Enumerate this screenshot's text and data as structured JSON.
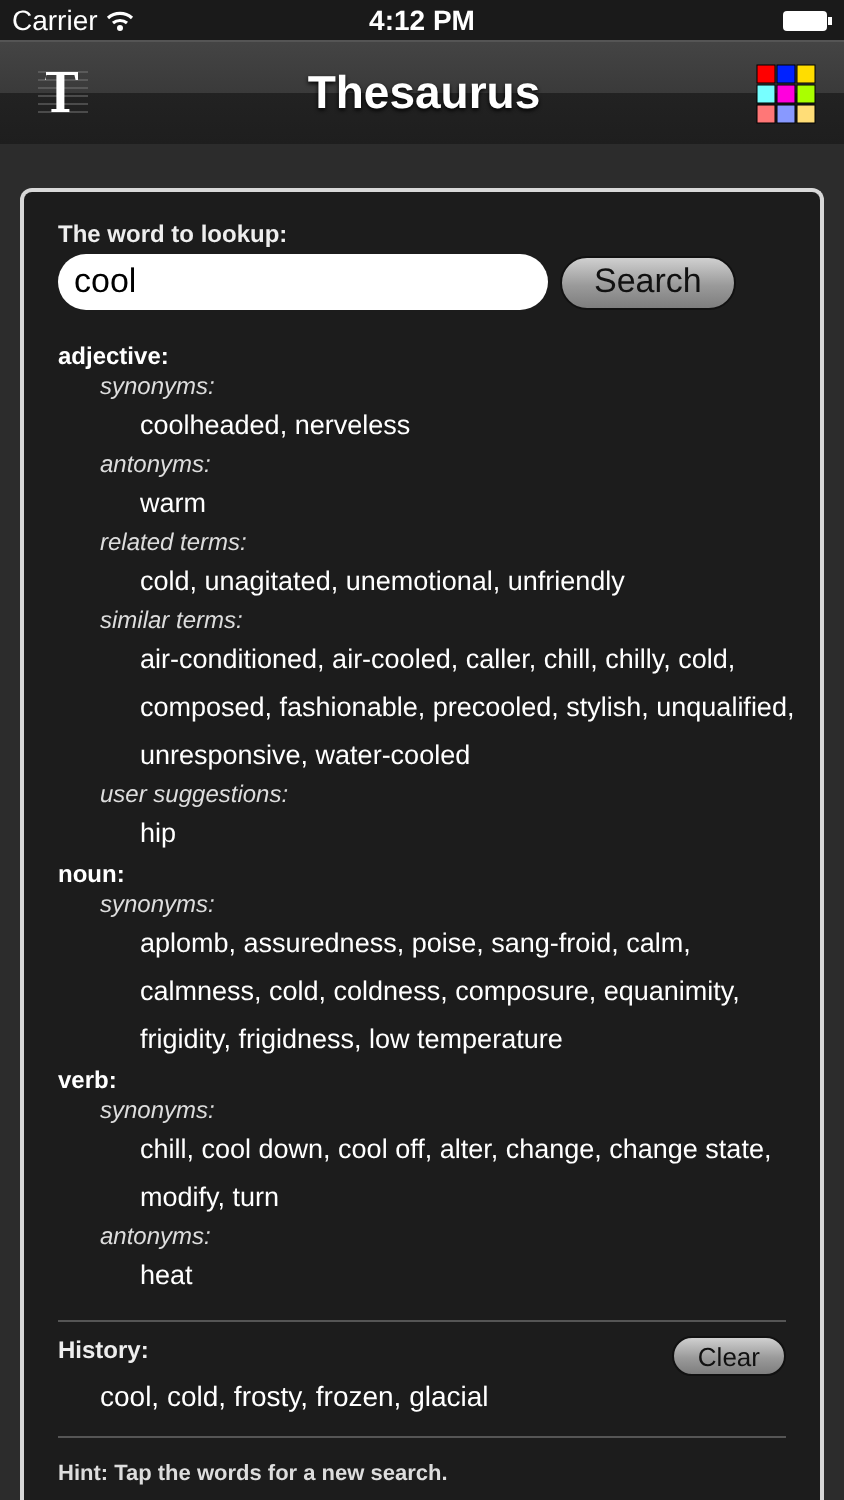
{
  "status_bar": {
    "carrier": "Carrier",
    "time": "4:12 PM"
  },
  "nav": {
    "title": "Thesaurus"
  },
  "search": {
    "label": "The word to lookup:",
    "value": "cool",
    "button": "Search"
  },
  "results": [
    {
      "part": "adjective:",
      "groups": [
        {
          "relation": "synonyms:",
          "lines": [
            "coolheaded, nerveless"
          ]
        },
        {
          "relation": "antonyms:",
          "lines": [
            "warm"
          ]
        },
        {
          "relation": "related terms:",
          "lines": [
            "cold, unagitated, unemotional, unfriendly"
          ]
        },
        {
          "relation": "similar terms:",
          "lines": [
            "air-conditioned, air-cooled, caller, chill, chilly, cold,",
            "composed, fashionable, precooled, stylish, unqualified,",
            "unresponsive, water-cooled"
          ]
        },
        {
          "relation": "user suggestions:",
          "lines": [
            "hip"
          ]
        }
      ]
    },
    {
      "part": "noun:",
      "groups": [
        {
          "relation": "synonyms:",
          "lines": [
            "aplomb, assuredness, poise, sang-froid, calm,",
            "calmness, cold, coldness, composure, equanimity,",
            "frigidity, frigidness, low temperature"
          ]
        }
      ]
    },
    {
      "part": "verb:",
      "groups": [
        {
          "relation": "synonyms:",
          "lines": [
            "chill, cool down, cool off, alter, change, change state,",
            "modify, turn"
          ]
        },
        {
          "relation": "antonyms:",
          "lines": [
            "heat"
          ]
        }
      ]
    }
  ],
  "history": {
    "label": "History:",
    "words": "cool, cold, frosty, frozen, glacial",
    "button": "Clear"
  },
  "hint": "Hint: Tap the words for a new search."
}
